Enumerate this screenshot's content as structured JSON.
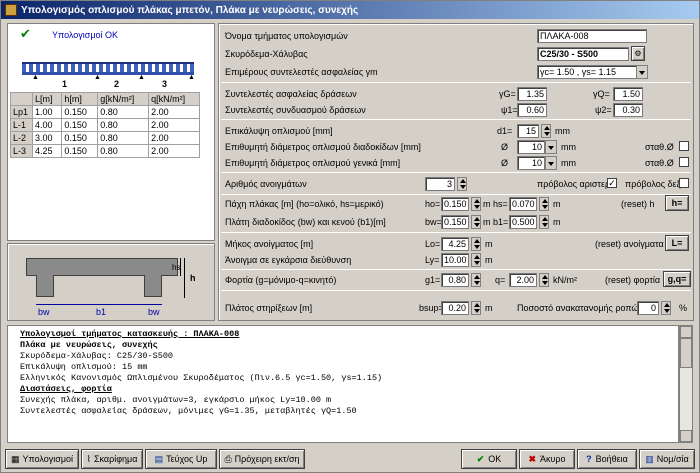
{
  "window": {
    "title": "Υπολογισμός οπλισμού πλάκας μπετόν, Πλάκα με νευρώσεις, συνεχής"
  },
  "left": {
    "status": "Υπολογισμοί OK",
    "spans_labels": [
      "1",
      "2",
      "3"
    ],
    "table": {
      "headers": [
        "",
        "L[m]",
        "h[m]",
        "g[kN/m²]",
        "q[kN/m²]"
      ],
      "rows": [
        [
          "Lp1",
          "1.00",
          "0.150",
          "0.80",
          "2.00"
        ],
        [
          "L-1",
          "4.00",
          "0.150",
          "0.80",
          "2.00"
        ],
        [
          "L-2",
          "3.00",
          "0.150",
          "0.80",
          "2.00"
        ],
        [
          "L-3",
          "4.25",
          "0.150",
          "0.80",
          "2.00"
        ]
      ]
    },
    "section_labels": {
      "hs": "hs",
      "h": "h",
      "bw1": "bw",
      "b1": "b1",
      "bw2": "bw"
    }
  },
  "form": {
    "name_label": "Όνομα τμήματος υπολογισμών",
    "name_value": "ΠΛΑΚΑ-008",
    "material_label": "Σκυρόδεμα-Χάλυβας",
    "material_value": "C25/30 - S500",
    "safety_label": "Επιμέρους συντελεστές ασφαλείας γm",
    "safety_value": "γc= 1.50 , γs= 1.15",
    "load_safety_label": "Συντελεστές ασφαλείας δράσεων",
    "gG_label": "γG=",
    "gG_value": "1.35",
    "gQ_label": "γQ=",
    "gQ_value": "1.50",
    "combo_label": "Συντελεστές συνδυασμού δράσεων",
    "psi1_label": "ψ1=",
    "psi1_value": "0.60",
    "psi2_label": "ψ2=",
    "psi2_value": "0.30",
    "cover_label": "Επικάλυψη οπλισμού [mm]",
    "d1_label": "d1=",
    "d1_value": "15",
    "mm1": "mm",
    "dist_diam_label": "Επιθυμητή διάμετρος οπλισμού διαδοκίδων [mm]",
    "phi1": "Ø",
    "dist_diam_value": "10",
    "mm2": "mm",
    "stab1": "σταθ.Ø",
    "gen_diam_label": "Επιθυμητή διάμετρος οπλισμού γενικά [mm]",
    "phi2": "Ø",
    "gen_diam_value": "10",
    "mm3": "mm",
    "stab2": "σταθ.Ø",
    "spans_label": "Αριθμός ανοιγμάτων",
    "spans_value": "3",
    "cant_left_label": "πρόβολος αριστερά",
    "cant_right_label": "πρόβολος δεξιά",
    "thick_label": "Πάχη πλάκας [m] (ho=ολικό, hs=μερικό)",
    "ho_label": "ho=",
    "ho_value": "0.150",
    "m_hs": "m hs=",
    "hs_value": "0.070",
    "m1": "m",
    "reset_h_label": "(reset) h",
    "reset_h_btn": "h=",
    "width_label": "Πλάτη διαδοκίδος (bw) και κενού (b1)[m]",
    "bw_label": "bw=",
    "bw_value": "0.150",
    "m_b1": "m b1=",
    "b1_value": "0.500",
    "m2": "m",
    "len_label": "Μήκος ανοίγματος [m]",
    "Lo_label": "Lo=",
    "Lo_value": "4.25",
    "m3": "m",
    "reset_L_label": "(reset) ανοίγματα",
    "reset_L_btn": "L=",
    "trans_label": "Άνοιγμα σε εγκάρσια διεύθυνση",
    "Ly_label": "Ly=",
    "Ly_value": "10.00",
    "m4": "m",
    "loads_label": "Φορτία (g=μόνιμο-q=κινητό)",
    "g1_label": "g1=",
    "g1_value": "0.80",
    "q_label": "q=",
    "q_value": "2.00",
    "knm": "kN/m²",
    "reset_load_label": "(reset) φορτία",
    "reset_load_btn": "g,q=",
    "support_label": "Πλάτος στηρίξεων [m]",
    "bsup_label": "bsup=",
    "bsup_value": "0.20",
    "m5": "m",
    "redist_label": "Ποσοστό ανακατανομής ροπών",
    "redist_value": "0",
    "pct": "%"
  },
  "report": [
    {
      "t": "Υπολογισμοί τμήματος κατασκευής : ΠΛΑΚΑ-008",
      "s": "bu"
    },
    {
      "t": "Πλάκα με νευρώσεις, συνεχής",
      "s": "b"
    },
    {
      "t": "Σκυρόδεμα-Χάλυβας: C25/30-S500",
      "s": ""
    },
    {
      "t": "Επικάλυψη οπλισμού: 15 mm",
      "s": ""
    },
    {
      "t": "Ελληνικός Κανονισμός Ωπλισμένου Σκυροδέματος (Πιν.6.5 γc=1.50, γs=1.15)",
      "s": ""
    },
    {
      "t": "Διαστάσεις, φορτία",
      "s": "bu"
    },
    {
      "t": "Συνεχής πλάκα, αριθμ. ανοιγμάτων=3, εγκάρσιο μήκος Ly=10.00 m",
      "s": ""
    },
    {
      "t": "Συντελεστές ασφαλείας δράσεων, μόνιμες γG=1.35, μεταβλητές γQ=1.50",
      "s": ""
    }
  ],
  "toolbar": {
    "calc": "Υπολογισμοί",
    "draw": "Σκαρίφημα",
    "book": "Τεύχος Up",
    "print": "Πρόχειρη εκτ/ση",
    "ok": "OK",
    "cancel": "Άκυρο",
    "help": "Βοήθεια",
    "units": "Νομ/σία"
  },
  "colors": {
    "title_bar": "#0a246a",
    "ok_check": "#008000",
    "status_text": "#0000c0"
  }
}
